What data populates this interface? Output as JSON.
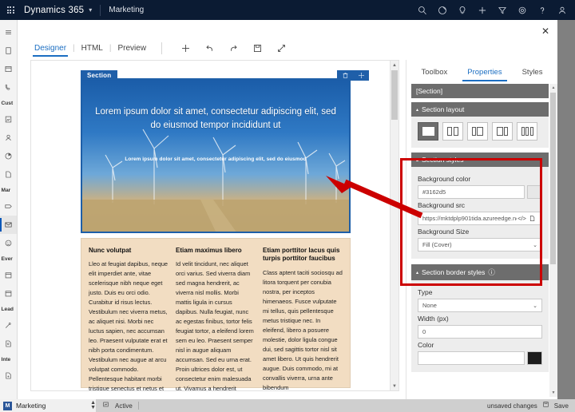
{
  "topbar": {
    "brand": "Dynamics 365",
    "app": "Marketing",
    "icons": [
      "waffle-icon",
      "search-icon",
      "edit-icon",
      "lightbulb-icon",
      "add-icon",
      "filter-icon",
      "settings-icon",
      "help-icon",
      "account-icon"
    ]
  },
  "sidebar": {
    "groups": [
      {
        "label": "Cust",
        "items": [
          "accounts-icon",
          "contacts-icon",
          "segments-icon",
          "pages-icon"
        ]
      },
      {
        "label": "Mar",
        "items": [
          "journeys-icon",
          "email-icon",
          "voice-icon"
        ]
      },
      {
        "label": "Ever",
        "items": [
          "events-icon",
          "event-calendar-icon"
        ]
      },
      {
        "label": "Lead",
        "items": [
          "leads-icon",
          "scoring-icon"
        ]
      },
      {
        "label": "Inte",
        "items": [
          "internal-icon"
        ]
      }
    ],
    "top_items": [
      "hamburger-icon",
      "recent-icon",
      "pinned-icon",
      "calls-icon"
    ],
    "selected": "email-icon"
  },
  "designer": {
    "close_label": "✕",
    "tabs": [
      {
        "label": "Designer",
        "active": true
      },
      {
        "label": "HTML",
        "active": false
      },
      {
        "label": "Preview",
        "active": false
      }
    ],
    "separator": "|",
    "tools": [
      "add-icon",
      "undo-icon",
      "redo-icon",
      "save-icon",
      "expand-icon"
    ]
  },
  "canvas": {
    "section_tag": "Section",
    "section_tools": [
      "delete-icon",
      "move-icon"
    ],
    "hero": {
      "headline": "Lorem ipsum dolor sit amet, consectetur adipiscing elit, sed do eiusmod tempor incididunt ut",
      "subtext": "Lorem ipsum dolor sit amet, consectetur adipiscing elit, sed do eiusmod"
    },
    "columns": [
      {
        "heading": "Nunc volutpat",
        "body": "Lleo at feugiat dapibus, neque elit imperdiet ante, vitae scelerisque nibh neque eget justo. Duis eu orci odio. Curabitur id risus lectus. Vestibulum nec viverra metus, ac aliquet nisi. Morbi nec luctus sapien, nec accumsan leo. Praesent vulputate erat et nibh porta condimentum. Vestibulum nec augue at arcu volutpat commodo. Pellentesque habitant morbi tristique senectus et netus et malesuada"
      },
      {
        "heading": "Etiam maximus libero",
        "body": "Id velit tincidunt, nec aliquet orci varius. Sed viverra diam sed magna hendrerit, ac viverra nisl mollis. Morbi mattis ligula in cursus dapibus. Nulla feugiat, nunc ac egestas finibus, tortor felis feugiat tortor, a eleifend lorem sem eu leo. Praesent semper nisl in augue aliquam accumsan. Sed eu urna erat. Proin ultrices dolor est, ut consectetur enim malesuada ut. Vivamus a hendrerit neque, non rhoncus enim. Nam"
      },
      {
        "heading": "Etiam porttitor lacus quis turpis porttitor faucibus",
        "body": "Class aptent taciti sociosqu ad litora torquent per conubia nostra, per inceptos himenaeos. Fusce vulputate mi tellus, quis pellentesque metus tristique nec. In eleifend, libero a posuere molestie, dolor ligula congue dui, sed sagittis tortor nisl sit amet libero. Ut quis hendrerit augue. Duis commodo, mi at convallis viverra, urna ante bibendum"
      }
    ]
  },
  "properties": {
    "tabs": [
      {
        "label": "Toolbox",
        "active": false
      },
      {
        "label": "Properties",
        "active": true
      },
      {
        "label": "Styles",
        "active": false
      }
    ],
    "selected_element": "[Section]",
    "section_layout": {
      "title": "Section layout",
      "caret": "▴",
      "options": [
        "one-column",
        "two-equal-columns",
        "two-columns-narrow-wide",
        "two-columns-wide-narrow",
        "three-columns"
      ],
      "selected_index": 0
    },
    "section_styles": {
      "title": "Section styles",
      "caret": "▴",
      "fields": [
        {
          "label": "Background color",
          "value": "#3162d5",
          "type": "color"
        },
        {
          "label": "Background src",
          "value": "https://mktdplp901tida.azureedge.net/c",
          "type": "text"
        },
        {
          "label": "Background Size",
          "value": "Fill (Cover)",
          "type": "select"
        }
      ]
    },
    "section_border_styles": {
      "title": "Section border styles",
      "caret": "▴",
      "info": "ⓘ",
      "fields": [
        {
          "label": "Type",
          "value": "None",
          "type": "select"
        },
        {
          "label": "Width (px)",
          "value": "0",
          "type": "text"
        },
        {
          "label": "Color",
          "value": "",
          "type": "color"
        }
      ]
    }
  },
  "statusbar": {
    "app_initial": "M",
    "app_name": "Marketing",
    "state": "Active",
    "unsaved": "unsaved changes",
    "save": "Save"
  },
  "colors": {
    "accent": "#1b6ec2",
    "nav": "#0b1b33",
    "section_blue": "#1f5fa9",
    "annotation_red": "#cc0000",
    "panel_header": "#6d6d6d",
    "cols_bg": "#f2ddc2"
  }
}
